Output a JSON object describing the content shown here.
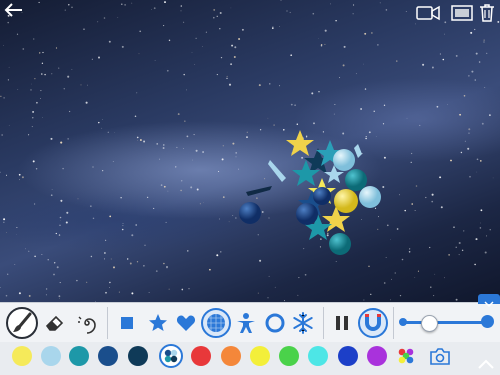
{
  "app": {
    "name": ""
  },
  "top_bar": {
    "back_icon": "back-arrow-icon",
    "video_icon": "video-camera-icon",
    "background_icon": "background-image-icon",
    "trash_icon": "trash-icon"
  },
  "tools": {
    "brush": "brush-icon",
    "eraser": "eraser-icon",
    "swirl": "swirl-icon",
    "shapes": [
      "square",
      "star",
      "heart",
      "sphere",
      "person",
      "ring",
      "snowflake"
    ],
    "selected_shape": "sphere",
    "pause": "pause-icon",
    "magnet": "magnet-icon",
    "size_slider": {
      "value": 0.3
    }
  },
  "palette": {
    "colors": [
      "#f5ea5a",
      "#a9d6ec",
      "#1d98a8",
      "#1a4e8c",
      "#0f3a58",
      "multi-blue",
      "#e8383a",
      "#f4873a",
      "#f3ef3a",
      "#4ad24a",
      "#4de6e6",
      "#1c3fc8",
      "#a932dc",
      "rainbow"
    ],
    "selected_color": "multi-blue",
    "camera_icon": "camera-icon",
    "expand_icon": "chevron-up-icon"
  },
  "colors": {
    "accent": "#2b78d8"
  }
}
